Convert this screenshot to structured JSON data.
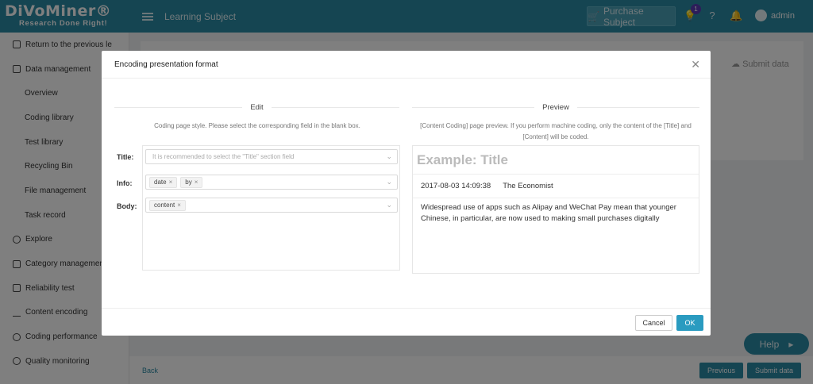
{
  "app": {
    "brand": "DiVoMiner®",
    "tagline": "Research Done Right!",
    "page_title": "Learning Subject",
    "purchase_label": "Purchase Subject",
    "notification_count": "1",
    "user": "admin"
  },
  "sidebar": {
    "items": [
      {
        "label": "Return to the previous le",
        "icon": "return-icon"
      },
      {
        "label": "Data management",
        "icon": "doc-icon"
      },
      {
        "label": "Overview"
      },
      {
        "label": "Coding library"
      },
      {
        "label": "Test library"
      },
      {
        "label": "Recycling Bin"
      },
      {
        "label": "File management"
      },
      {
        "label": "Task record"
      },
      {
        "label": "Explore",
        "icon": "explore-icon"
      },
      {
        "label": "Category management",
        "icon": "doc-icon"
      },
      {
        "label": "Reliability test",
        "icon": "chart-icon"
      },
      {
        "label": "Content encoding",
        "icon": "pen-icon"
      },
      {
        "label": "Coding performance",
        "icon": "target-icon"
      },
      {
        "label": "Quality monitoring",
        "icon": "eye-icon"
      }
    ]
  },
  "background": {
    "submit_top": "Submit data",
    "back": "Back",
    "previous": "Previous",
    "submit": "Submit data",
    "help": "Help"
  },
  "modal": {
    "title": "Encoding presentation format",
    "edit": {
      "heading": "Edit",
      "description": "Coding page style. Please select the corresponding field in the blank box.",
      "fields": [
        {
          "label": "Title:",
          "placeholder": "It is recommended to select the \"Title\" section field",
          "tags": []
        },
        {
          "label": "Info:",
          "placeholder": "",
          "tags": [
            "date",
            "by"
          ]
        },
        {
          "label": "Body:",
          "placeholder": "",
          "tags": [
            "content"
          ]
        }
      ]
    },
    "preview": {
      "heading": "Preview",
      "description": "[Content Coding] page preview. If you perform machine coding, only the content of the [Title] and [Content] will be coded.",
      "example_title": "Example: Title",
      "date": "2017-08-03 14:09:38",
      "source": "The Economist",
      "body": "Widespread use of apps such as Alipay and WeChat Pay mean that younger Chinese, in particular, are now used to making small purchases digitally"
    },
    "cancel": "Cancel",
    "ok": "OK"
  }
}
